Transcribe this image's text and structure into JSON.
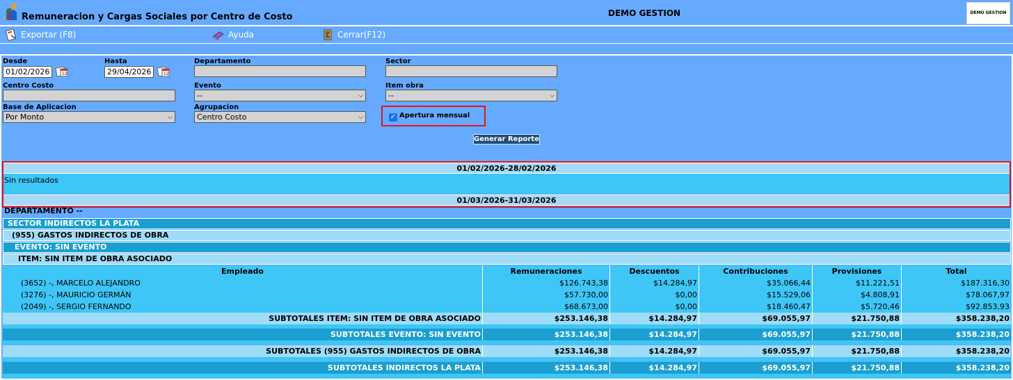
{
  "window": {
    "title": "Remuneracion y Cargas Sociales por Centro de Costo",
    "company": "DEMO GESTION",
    "logo_text": "DEMO GESTION"
  },
  "toolbar": {
    "export_label": "Exportar (F8)",
    "help_label": "Ayuda",
    "close_label": "Cerrar(F12)"
  },
  "filters": {
    "desde_label": "Desde",
    "desde_value": "01/02/2026",
    "hasta_label": "Hasta",
    "hasta_value": "29/04/2026",
    "departamento_label": "Departamento",
    "departamento_value": "",
    "sector_label": "Sector",
    "sector_value": "",
    "centro_costo_label": "Centro Costo",
    "centro_costo_value": "",
    "evento_label": "Evento",
    "evento_value": "--",
    "item_obra_label": "Item obra",
    "item_obra_value": "--",
    "base_label": "Base de Aplicacion",
    "base_value": "Por Monto",
    "agrupacion_label": "Agrupacion",
    "agrupacion_value": "Centro Costo",
    "apertura_label": "Apertura mensual",
    "apertura_checked": true,
    "generate_label": "Generar Reporte"
  },
  "report": {
    "period1": "01/02/2026-28/02/2026",
    "no_results": "Sin resultados",
    "period2": "01/03/2026-31/03/2026",
    "departamento": "DEPARTAMENTO --",
    "sector": "SECTOR INDIRECTOS LA PLATA",
    "centro": "(955) GASTOS INDIRECTOS DE OBRA",
    "evento": "EVENTO: SIN EVENTO",
    "item": "ITEM: SIN ITEM DE OBRA ASOCIADO",
    "columns": [
      "Empleado",
      "Remuneraciones",
      "Descuentos",
      "Contribuciones",
      "Provisiones",
      "Total"
    ],
    "rows": [
      [
        "(3652) -, MARCELO ALEJANDRO",
        "$126.743,38",
        "$14.284,97",
        "$35.066,44",
        "$11.221,51",
        "$187.316,30"
      ],
      [
        "(3276) -, MAURICIO GERMÁN",
        "$57.730,00",
        "$0,00",
        "$15.529,06",
        "$4.808,91",
        "$78.067,97"
      ],
      [
        "(2049) -, SERGIO FERNANDO",
        "$68.673,00",
        "$0,00",
        "$18.460,47",
        "$5.720,46",
        "$92.853,93"
      ]
    ],
    "subtotals": [
      [
        "SUBTOTALES ITEM: SIN ITEM DE OBRA ASOCIADO",
        "$253.146,38",
        "$14.284,97",
        "$69.055,97",
        "$21.750,88",
        "$358.238,20"
      ],
      [
        "SUBTOTALES EVENTO: SIN EVENTO",
        "$253.146,38",
        "$14.284,97",
        "$69.055,97",
        "$21.750,88",
        "$358.238,20"
      ],
      [
        "SUBTOTALES (955) GASTOS INDIRECTOS DE OBRA",
        "$253.146,38",
        "$14.284,97",
        "$69.055,97",
        "$21.750,88",
        "$358.238,20"
      ],
      [
        "SUBTOTALES INDIRECTOS LA PLATA",
        "$253.146,38",
        "$14.284,97",
        "$69.055,97",
        "$21.750,88",
        "$358.238,20"
      ]
    ]
  },
  "colors": {
    "panel": "#66aaff",
    "highlight": "#e0161c",
    "dark_group": "#1a9fd0",
    "row": "#3ec6f7",
    "light_group": "#9fdcf8"
  },
  "icons": [
    "app-logo-icon",
    "export-icon",
    "help-icon",
    "close-icon",
    "calendar-icon",
    "checkbox-checked-icon"
  ]
}
